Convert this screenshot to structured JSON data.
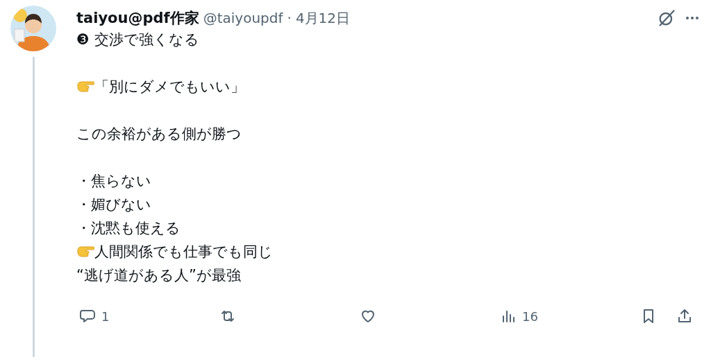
{
  "post": {
    "author": "taiyou@pdf作家",
    "handle": "@taiyoupdf",
    "separator": "·",
    "date": "4月12日",
    "paragraphs": [
      [
        {
          "text": "❸ 交渉で強くなる",
          "pointer": false
        }
      ],
      [
        {
          "text": "「別にダメでもいい」",
          "pointer": true
        }
      ],
      [
        {
          "text": "この余裕がある側が勝つ",
          "pointer": false
        }
      ],
      [
        {
          "text": "・焦らない",
          "pointer": false
        },
        {
          "text": "・媚びない",
          "pointer": false
        },
        {
          "text": "・沈黙も使える",
          "pointer": false
        },
        {
          "text": "人間関係でも仕事でも同じ",
          "pointer": true
        },
        {
          "text": "“逃げ道がある人”が最強",
          "pointer": false
        }
      ]
    ],
    "actions": [
      {
        "kind": "reply",
        "count": "1"
      },
      {
        "kind": "repost"
      },
      {
        "kind": "like"
      },
      {
        "kind": "views",
        "count": "16"
      },
      {
        "kind": "bookmark"
      },
      {
        "kind": "share"
      }
    ]
  }
}
